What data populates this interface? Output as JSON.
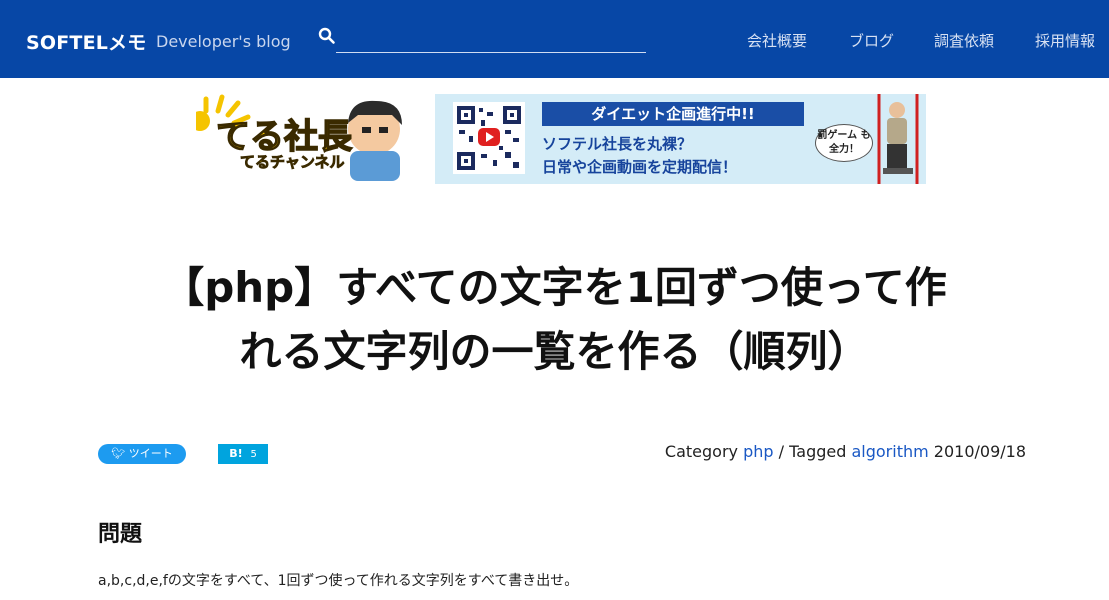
{
  "header": {
    "logo": "SOFTELメモ",
    "subtitle": "Developer's blog",
    "search_value": "",
    "nav": [
      "会社概要",
      "ブログ",
      "調査依頼",
      "採用情報"
    ],
    "brand_color": "#0747a6"
  },
  "banners": {
    "left": {
      "line1": "てる社長",
      "line2": "てるチャンネル"
    },
    "right": {
      "headline": "ダイエット企画進行中!!",
      "line1": "ソフテル社長を丸裸？",
      "line2": "日常や企画動画を定期配信！",
      "badge": "罰ゲーム も全力！"
    }
  },
  "article": {
    "title_line1": "【php】すべての文字を1回ずつ使って作",
    "title_line2": "れる文字列の一覧を作る（順列）",
    "tweet_label": "ツイート",
    "hatena_label": "B!",
    "hatena_count": "5",
    "meta": {
      "category_prefix": "Category",
      "category": "php",
      "tag_prefix": "/ Tagged",
      "tag": "algorithm",
      "date": "2010/09/18"
    },
    "section_title": "問題",
    "paragraph": "a,b,c,d,e,fの文字をすべて、1回ずつ使って作れる文字列をすべて書き出せ。"
  }
}
